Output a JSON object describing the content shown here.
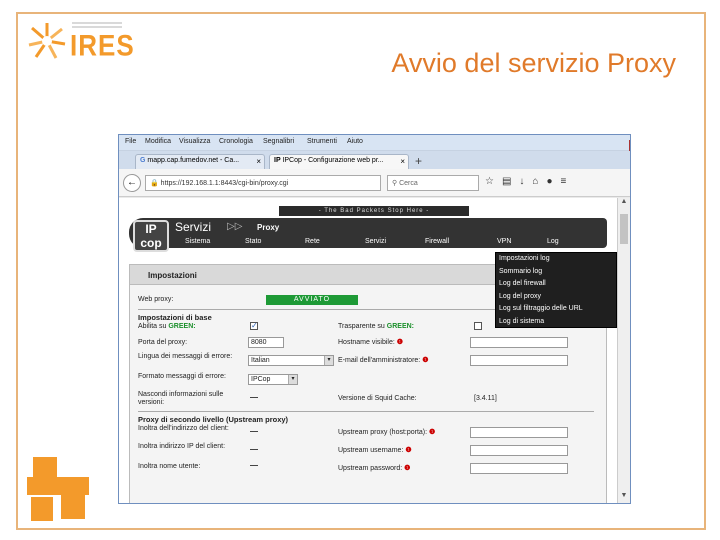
{
  "slide": {
    "title": "Avvio del servizio Proxy",
    "logo_text": "IRES"
  },
  "browser": {
    "menu": [
      "File",
      "Modifica",
      "Visualizza",
      "Cronologia",
      "Segnalibri",
      "Strumenti",
      "Aiuto"
    ],
    "tabs": [
      {
        "label": "mapp.cap.fumedov.net - Ca..."
      },
      {
        "label": "IPCop - Configurazione web pr..."
      }
    ],
    "url": "https://192.168.1.1:8443/cgi-bin/proxy.cgi",
    "search_placeholder": "Cerca"
  },
  "ipcop": {
    "slogan": "- The Bad Packets Stop Here -",
    "logo": "IP cop",
    "section": "Servizi",
    "breadcrumb": "Proxy",
    "menu": [
      "Sistema",
      "Stato",
      "Rete",
      "Servizi",
      "Firewall",
      "VPN",
      "Log"
    ],
    "log_menu": [
      "Impostazioni log",
      "Sommario log",
      "Log del firewall",
      "Log del proxy",
      "Log sul filtraggio delle URL",
      "Log di sistema"
    ]
  },
  "panel": {
    "title": "Impostazioni",
    "web_proxy_label": "Web proxy:",
    "status": "AVVIATO",
    "basic_section": "Impostazioni di base",
    "enable_green_label": "Abilita su",
    "green": "GREEN:",
    "transparent_label": "Trasparente su",
    "proxy_port_label": "Porta del proxy:",
    "proxy_port_value": "8080",
    "visible_host_label": "Hostname visibile:",
    "error_lang_label": "Lingua dei messaggi di errore:",
    "error_lang_value": "Italian",
    "admin_email_label": "E-mail dell'amministratore:",
    "error_design_label": "Formato messaggi di errore:",
    "error_design_value": "IPCop",
    "suppress_label": "Nascondi informazioni sulle versioni:",
    "squid_version_label": "Versione di Squid Cache:",
    "squid_version_value": "[3.4.11]",
    "upstream_section": "Proxy di secondo livello (Upstream proxy)",
    "upstream_ip_label": "Inoltra dell'indirizzo del client:",
    "upstream_server_label": "Upstream proxy (host:porta):",
    "client_ip_label": "Inoltra indirizzo IP del client:",
    "upstream_user_label": "Upstream username:",
    "username_fwd_label": "Inoltra nome utente:",
    "upstream_pass_label": "Upstream password:"
  }
}
